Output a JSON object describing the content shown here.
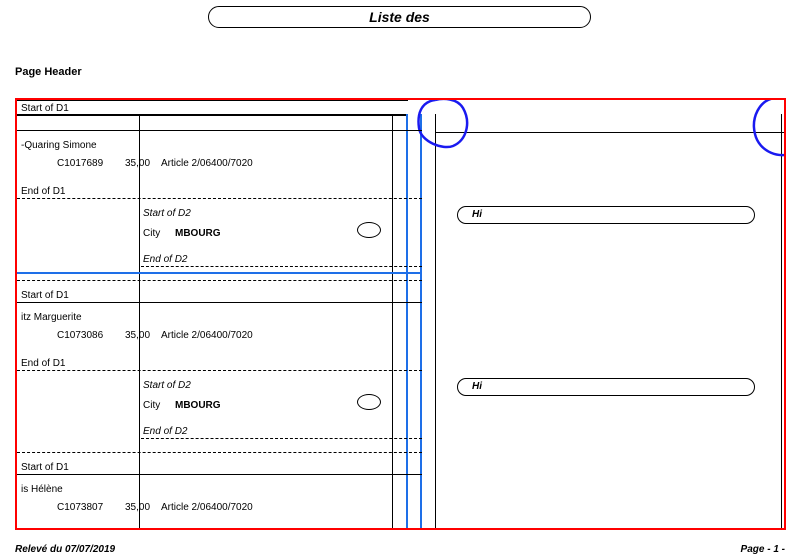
{
  "title": "Liste des",
  "page_header_label": "Page Header",
  "footer": {
    "left": "Relevé du 07/07/2019",
    "right": "Page - 1 -"
  },
  "labels": {
    "start_d1": "Start of D1",
    "end_d1": "End of D1",
    "start_d2": "Start of D2",
    "end_d2": "End of D2",
    "city_label": "City",
    "hi": "Hi"
  },
  "records": [
    {
      "name": "-Quaring Simone",
      "code": "C1017689",
      "amount": "35,00",
      "article": "Article 2/06400/7020",
      "d2_city": "MBOURG",
      "show_d2": true
    },
    {
      "name": "itz Marguerite",
      "code": "C1073086",
      "amount": "35,00",
      "article": "Article 2/06400/7020",
      "d2_city": "MBOURG",
      "show_d2": true
    },
    {
      "name": "is Hélène",
      "code": "C1073807",
      "amount": "35,00",
      "article": "Article 2/06400/7020",
      "show_d2": false
    }
  ]
}
